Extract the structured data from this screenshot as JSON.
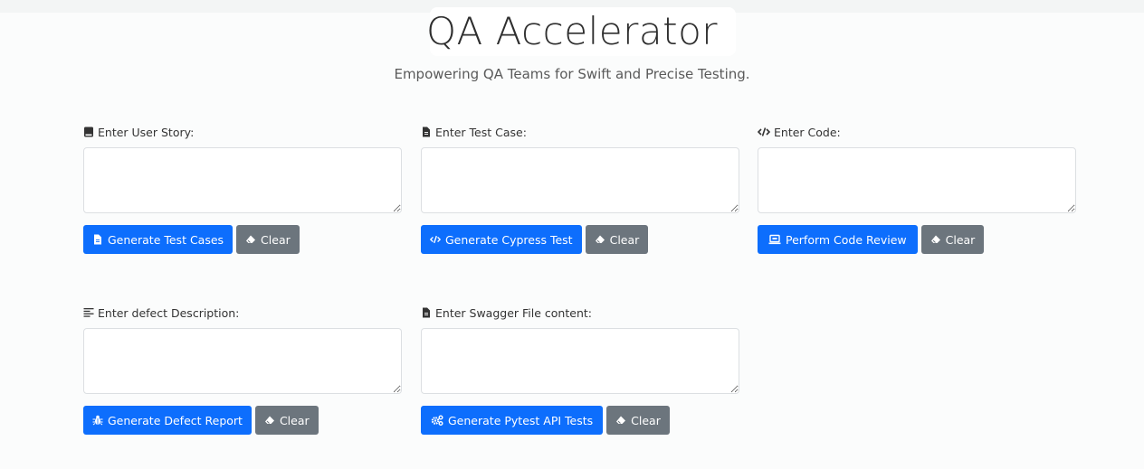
{
  "header": {
    "title": "QA Accelerator",
    "subtitle": "Empowering QA Teams for Swift and Precise Testing."
  },
  "colors": {
    "primary": "#0d6efd",
    "secondary": "#6c757d"
  },
  "sections": [
    {
      "label": "Enter User Story:",
      "label_icon": "book-icon",
      "textarea_value": "",
      "primary_button": {
        "label": "Generate Test Cases",
        "icon": "file-icon"
      },
      "clear_button": {
        "label": "Clear",
        "icon": "eraser-icon"
      }
    },
    {
      "label": "Enter Test Case:",
      "label_icon": "file-icon",
      "textarea_value": "",
      "primary_button": {
        "label": "Generate Cypress Test",
        "icon": "code-icon"
      },
      "clear_button": {
        "label": "Clear",
        "icon": "eraser-icon"
      }
    },
    {
      "label": "Enter Code:",
      "label_icon": "code-icon",
      "textarea_value": "",
      "primary_button": {
        "label": "Perform Code Review",
        "icon": "laptop-icon"
      },
      "clear_button": {
        "label": "Clear",
        "icon": "eraser-icon"
      }
    },
    {
      "label": "Enter defect Description:",
      "label_icon": "align-left-icon",
      "textarea_value": "",
      "primary_button": {
        "label": "Generate Defect Report",
        "icon": "bug-icon"
      },
      "clear_button": {
        "label": "Clear",
        "icon": "eraser-icon"
      }
    },
    {
      "label": "Enter Swagger File content:",
      "label_icon": "file-icon",
      "textarea_value": "",
      "primary_button": {
        "label": "Generate Pytest API Tests",
        "icon": "cogs-icon"
      },
      "clear_button": {
        "label": "Clear",
        "icon": "eraser-icon"
      }
    }
  ]
}
